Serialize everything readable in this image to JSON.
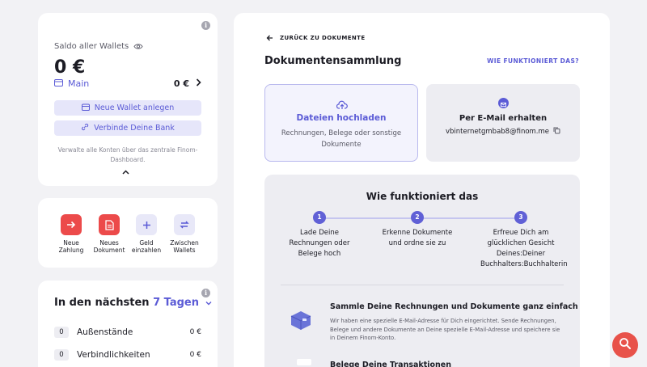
{
  "wallet": {
    "label": "Saldo aller Wallets",
    "total": "0 €",
    "main_name": "Main",
    "main_amount": "0 €",
    "new_wallet": "Neue Wallet anlegen",
    "connect_bank": "Verbinde Deine Bank",
    "note": "Verwalte alle Konten über das zentrale Finom-Dashboard."
  },
  "quick_actions": [
    {
      "label": "Neue Zahlung",
      "style": "red",
      "icon": "arrow-right-icon"
    },
    {
      "label": "Neues Dokument",
      "style": "red",
      "icon": "document-icon"
    },
    {
      "label": "Geld einzahlen",
      "style": "lavender",
      "icon": "plus-icon"
    },
    {
      "label": "Zwischen Wallets",
      "style": "lavender",
      "icon": "swap-icon"
    }
  ],
  "upcoming": {
    "title_prefix": "In den nächsten",
    "period": "7 Tagen",
    "rows": [
      {
        "count": "0",
        "label": "Außenstände",
        "value": "0 €"
      },
      {
        "count": "0",
        "label": "Verbindlichkeiten",
        "value": "0 €"
      }
    ]
  },
  "main": {
    "back": "ZURÜCK ZU DOKUMENTE",
    "title": "Dokumentensammlung",
    "how_link": "WIE FUNKTIONIERT DAS?",
    "upload_title": "Dateien hochladen",
    "upload_sub": "Rechnungen, Belege oder sonstige Dokumente",
    "mail_title": "Per E-Mail erhalten",
    "mail_address": "vbinternetgmbab8@finom.me",
    "how_title": "Wie funktioniert das",
    "steps": [
      {
        "n": "1",
        "text": "Lade Deine Rechnungen oder Belege hoch"
      },
      {
        "n": "2",
        "text": "Erkenne Dokumente und ordne sie zu"
      },
      {
        "n": "3",
        "text": "Erfreue Dich am glücklichen Gesicht Deines:Deiner Buchhalters:Buchhalterin"
      }
    ],
    "feature1_title": "Sammle Deine Rechnungen und Dokumente ganz einfach",
    "feature1_desc": "Wir haben eine spezielle E-Mail-Adresse für Dich eingerichtet. Sende Rechnungen, Belege und andere Dokumente an Deine spezielle E-Mail-Adresse und speichere sie in Deinem Finom-Konto.",
    "feature2_title": "Belege Deine Transaktionen"
  },
  "colors": {
    "accent": "#5b5bd6",
    "red": "#ec4a4a",
    "fab": "#e8524a"
  }
}
